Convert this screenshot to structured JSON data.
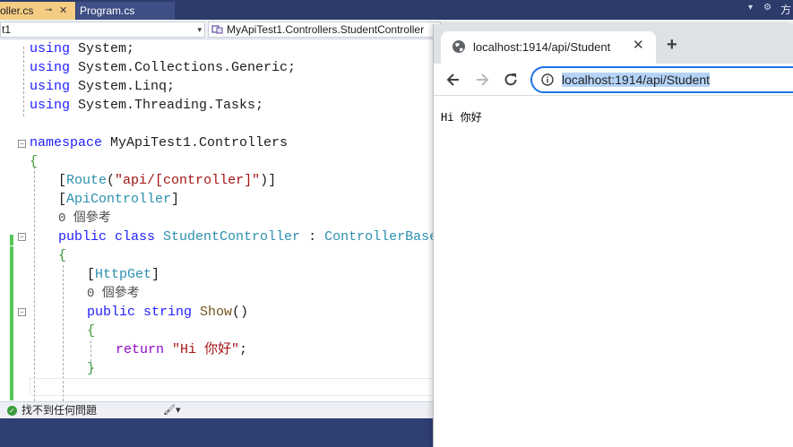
{
  "ide": {
    "tabs": [
      {
        "label": "roller.cs",
        "pin": "⊸",
        "close": "✕"
      },
      {
        "label": "Program.cs"
      }
    ],
    "tabbar_right": {
      "dropdown": "▾",
      "settings": "⚙",
      "strip_char": "方"
    },
    "nav": {
      "combo1": "t1",
      "combo1_arrow": "▾",
      "combo2": "MyApiTest1.Controllers.StudentController"
    },
    "code": {
      "using1_kw": "using",
      "using1_ns": " System;",
      "using2_kw": "using",
      "using2_ns": " System.Collections.Generic;",
      "using3_kw": "using",
      "using3_ns": " System.Linq;",
      "using4_kw": "using",
      "using4_ns": " System.Threading.Tasks;",
      "ns_kw": "namespace",
      "ns_name": " MyApiTest1.Controllers",
      "brace_open": "{",
      "route_open": "[",
      "route_attr": "Route",
      "route_paren": "(",
      "route_str": "\"api/[controller]\"",
      "route_close": ")]",
      "apictrl_open": "[",
      "apictrl_attr": "ApiController",
      "apictrl_close": "]",
      "refs1": "0 個參考",
      "class_kw1": "public",
      "class_kw2": " class",
      "class_name": " StudentController",
      "class_colon": " :",
      "class_base": " ControllerBase",
      "class_brace_open": "{",
      "httpget_open": "[",
      "httpget_attr": "HttpGet",
      "httpget_close": "]",
      "refs2": "0 個參考",
      "method_kw1": "public",
      "method_kw2": " string",
      "method_name": " Show",
      "method_parens": "()",
      "method_brace_open": "{",
      "return_kw": "return",
      "return_str": " \"Hi 你好\"",
      "return_semi": ";",
      "method_brace_close": "}"
    },
    "status": {
      "icon": "✓",
      "text": "找不到任何問題",
      "brush": "🖌▾"
    }
  },
  "browser": {
    "tab_title": "localhost:1914/api/Student",
    "tab_close": "✕",
    "new_tab": "+",
    "url": "localhost:1914/api/Student",
    "body": "Hi 你好"
  },
  "colors": {
    "ide_tabbar": "#2d3b6b",
    "active_tab": "#f5cc84",
    "keyword": "#1f1fff",
    "type": "#2b91af",
    "string": "#a31515",
    "control": "#8f08c4",
    "omnibox_border": "#1a73e8",
    "url_selection": "#b5d3f7"
  }
}
